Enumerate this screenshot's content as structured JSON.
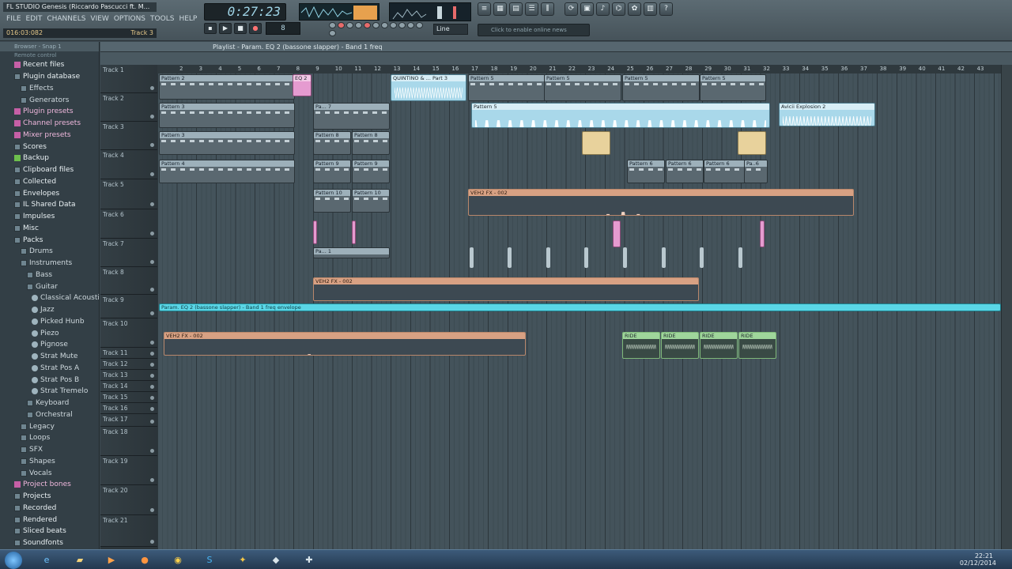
{
  "app": {
    "title": "FL STUDIO   Genesis (Riccardo Pascucci ft. M...",
    "menu": [
      "FILE",
      "EDIT",
      "CHANNELS",
      "VIEW",
      "OPTIONS",
      "TOOLS",
      "HELP"
    ],
    "hint_time": "016:03:082",
    "hint_track": "Track 3"
  },
  "transport": {
    "time": "0:27:23",
    "tempo": "8"
  },
  "snap": "Line",
  "news": "Click to enable online news",
  "browser": {
    "header": "Browser - Snap 1",
    "subheader": "Remote control",
    "items": [
      {
        "label": "Recent files",
        "lvl": 0,
        "ic": "pink"
      },
      {
        "label": "Plugin database",
        "lvl": 0,
        "ic": "folder"
      },
      {
        "label": "Effects",
        "lvl": 1,
        "ic": "folder"
      },
      {
        "label": "Generators",
        "lvl": 1,
        "ic": "folder"
      },
      {
        "label": "Plugin presets",
        "lvl": 0,
        "ic": "pink",
        "pink": true
      },
      {
        "label": "Channel presets",
        "lvl": 0,
        "ic": "pink",
        "pink": true
      },
      {
        "label": "Mixer presets",
        "lvl": 0,
        "ic": "pink",
        "pink": true
      },
      {
        "label": "Scores",
        "lvl": 0,
        "ic": "folder"
      },
      {
        "label": "Backup",
        "lvl": 0,
        "ic": "green"
      },
      {
        "label": "Clipboard files",
        "lvl": 0,
        "ic": "folder"
      },
      {
        "label": "Collected",
        "lvl": 0,
        "ic": "folder"
      },
      {
        "label": "Envelopes",
        "lvl": 0,
        "ic": "folder"
      },
      {
        "label": "IL Shared Data",
        "lvl": 0,
        "ic": "folder"
      },
      {
        "label": "Impulses",
        "lvl": 0,
        "ic": "folder"
      },
      {
        "label": "Misc",
        "lvl": 0,
        "ic": "folder"
      },
      {
        "label": "Packs",
        "lvl": 0,
        "ic": "folder"
      },
      {
        "label": "Drums",
        "lvl": 1,
        "ic": "folder"
      },
      {
        "label": "Instruments",
        "lvl": 1,
        "ic": "folder"
      },
      {
        "label": "Bass",
        "lvl": 2,
        "ic": "folder"
      },
      {
        "label": "Guitar",
        "lvl": 2,
        "ic": "folder"
      },
      {
        "label": "Classical Acoustic",
        "lvl": 3,
        "ic": "sub"
      },
      {
        "label": "Jazz",
        "lvl": 3,
        "ic": "sub"
      },
      {
        "label": "Picked Hunb",
        "lvl": 3,
        "ic": "sub"
      },
      {
        "label": "Piezo",
        "lvl": 3,
        "ic": "sub"
      },
      {
        "label": "Pignose",
        "lvl": 3,
        "ic": "sub"
      },
      {
        "label": "Strat Mute",
        "lvl": 3,
        "ic": "sub"
      },
      {
        "label": "Strat Pos A",
        "lvl": 3,
        "ic": "sub"
      },
      {
        "label": "Strat Pos B",
        "lvl": 3,
        "ic": "sub"
      },
      {
        "label": "Strat Tremelo",
        "lvl": 3,
        "ic": "sub"
      },
      {
        "label": "Keyboard",
        "lvl": 2,
        "ic": "folder"
      },
      {
        "label": "Orchestral",
        "lvl": 2,
        "ic": "folder"
      },
      {
        "label": "Legacy",
        "lvl": 1,
        "ic": "folder"
      },
      {
        "label": "Loops",
        "lvl": 1,
        "ic": "folder"
      },
      {
        "label": "SFX",
        "lvl": 1,
        "ic": "folder"
      },
      {
        "label": "Shapes",
        "lvl": 1,
        "ic": "folder"
      },
      {
        "label": "Vocals",
        "lvl": 1,
        "ic": "folder"
      },
      {
        "label": "Project bones",
        "lvl": 0,
        "ic": "pink",
        "pink": true
      },
      {
        "label": "Projects",
        "lvl": 0,
        "ic": "folder"
      },
      {
        "label": "Recorded",
        "lvl": 0,
        "ic": "folder"
      },
      {
        "label": "Rendered",
        "lvl": 0,
        "ic": "folder"
      },
      {
        "label": "Sliced beats",
        "lvl": 0,
        "ic": "folder"
      },
      {
        "label": "Soundfonts",
        "lvl": 0,
        "ic": "folder"
      }
    ]
  },
  "playlist": {
    "title": "Playlist - Param. EQ 2 (bassone slapper) - Band 1 freq",
    "tracks": [
      "Track 1",
      "Track 2",
      "Track 3",
      "Track 4",
      "Track 5",
      "Track 6",
      "Track 7",
      "Track 8",
      "Track 9",
      "Track 10",
      "Track 11",
      "Track 12",
      "Track 13",
      "Track 14",
      "Track 15",
      "Track 16",
      "Track 17",
      "Track 18",
      "Track 19",
      "Track 20",
      "Track 21"
    ],
    "bars": [
      "2",
      "3",
      "4",
      "5",
      "6",
      "7",
      "8",
      "9",
      "10",
      "11",
      "12",
      "13",
      "14",
      "15",
      "16",
      "17",
      "18",
      "19",
      "20",
      "21",
      "22",
      "23",
      "24",
      "25",
      "26",
      "27",
      "28",
      "29",
      "30",
      "31",
      "32",
      "33",
      "34",
      "35",
      "36",
      "37",
      "38",
      "39",
      "40",
      "41",
      "42",
      "43"
    ],
    "clips": [
      {
        "t": 0,
        "k": "pat",
        "label": "Pattern 2"
      },
      {
        "t": 0,
        "k": "pink",
        "label": "EQ 2"
      },
      {
        "t": 0,
        "k": "blue",
        "label": "QUINTINO & ... Part 3"
      },
      {
        "t": 0,
        "k": "pat",
        "label": "Pattern 5"
      },
      {
        "t": 0,
        "k": "pat",
        "label": "Pattern 5"
      },
      {
        "t": 0,
        "k": "pat",
        "label": "Pattern 5"
      },
      {
        "t": 0,
        "k": "pat",
        "label": "Pattern 5"
      },
      {
        "t": 1,
        "k": "pat",
        "label": "Pattern 3"
      },
      {
        "t": 1,
        "k": "pat",
        "label": "Pa... 7"
      },
      {
        "t": 1,
        "k": "blue",
        "label": "Pattern 5"
      },
      {
        "t": 1,
        "k": "blue",
        "label": "Avicii Explosion 2"
      },
      {
        "t": 2,
        "k": "pat",
        "label": "Pattern 3"
      },
      {
        "t": 2,
        "k": "pat",
        "label": "Pattern 8"
      },
      {
        "t": 2,
        "k": "pat",
        "label": "Pattern 8"
      },
      {
        "t": 3,
        "k": "pat",
        "label": "Pattern 4"
      },
      {
        "t": 3,
        "k": "pat",
        "label": "Pattern 9"
      },
      {
        "t": 3,
        "k": "pat",
        "label": "Pattern 9"
      },
      {
        "t": 3,
        "k": "pat",
        "label": "Pattern 6"
      },
      {
        "t": 3,
        "k": "pat",
        "label": "Pattern 6"
      },
      {
        "t": 3,
        "k": "pat",
        "label": "Pattern 6"
      },
      {
        "t": 3,
        "k": "pat",
        "label": "Pa..6"
      },
      {
        "t": 4,
        "k": "pat",
        "label": "Pattern 10"
      },
      {
        "t": 4,
        "k": "pat",
        "label": "Pattern 10"
      },
      {
        "t": 4,
        "k": "orange",
        "label": "VEH2 FX - 002"
      },
      {
        "t": 6,
        "k": "pat",
        "label": "Pa... 1"
      },
      {
        "t": 7,
        "k": "orange",
        "label": "VEH2 FX - 002"
      },
      {
        "t": 8,
        "k": "env",
        "label": "Param. EQ 2 (bassone slapper) - Band 1 freq envelope"
      },
      {
        "t": 9,
        "k": "orange",
        "label": "VEH2 FX - 002"
      },
      {
        "t": 9,
        "k": "green",
        "label": "RIDE"
      },
      {
        "t": 9,
        "k": "green",
        "label": "RIDE"
      },
      {
        "t": 9,
        "k": "green",
        "label": "RIDE"
      },
      {
        "t": 9,
        "k": "green",
        "label": "RIDE"
      }
    ]
  },
  "taskbar": {
    "time": "22:21",
    "date": "02/12/2014"
  },
  "colors": {
    "bg": "#3d4a52",
    "env": "#37c3d4",
    "blue": "#a9d8ea",
    "orange": "#d8a183",
    "pink": "#e59bd0",
    "green": "#9fd69b"
  }
}
